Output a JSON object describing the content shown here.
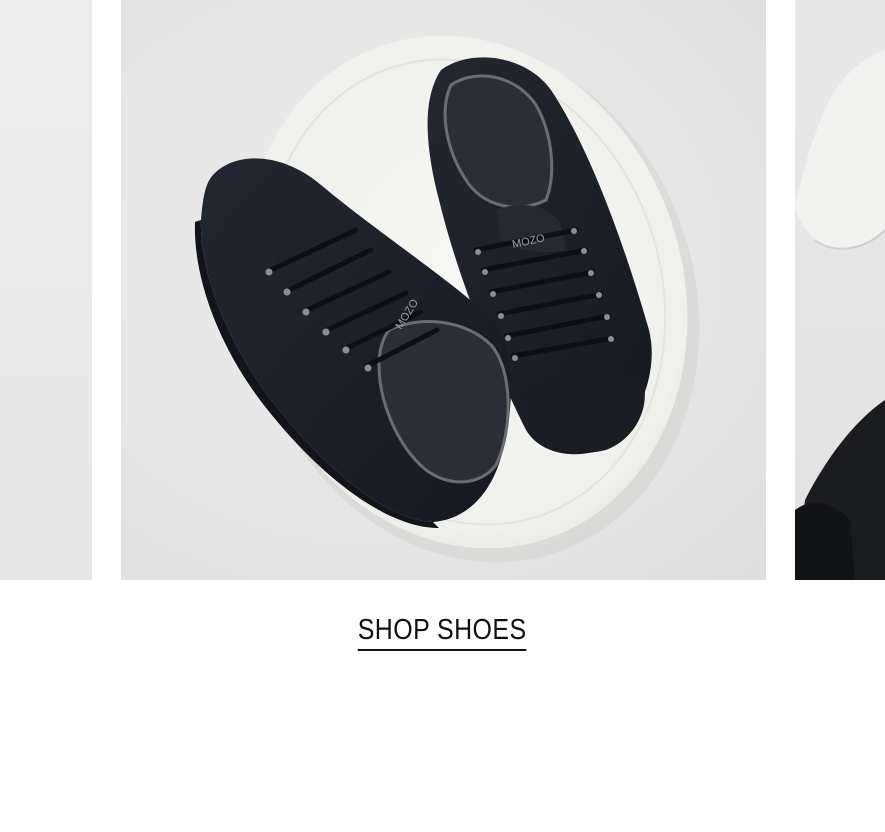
{
  "carousel": {
    "prev_slide": {
      "image": "light-grey-photo"
    },
    "main_slide": {
      "image": "black-sneakers-on-white-plate",
      "shoe_brand_mark": "MOZO"
    },
    "next_slide": {
      "image": "person-in-white-and-black-clothing"
    }
  },
  "cta": {
    "label": "SHOP SHOES"
  },
  "colors": {
    "text": "#111111",
    "background": "#ffffff",
    "shoe": "#1c1f26",
    "plate": "#f3f3ef"
  }
}
